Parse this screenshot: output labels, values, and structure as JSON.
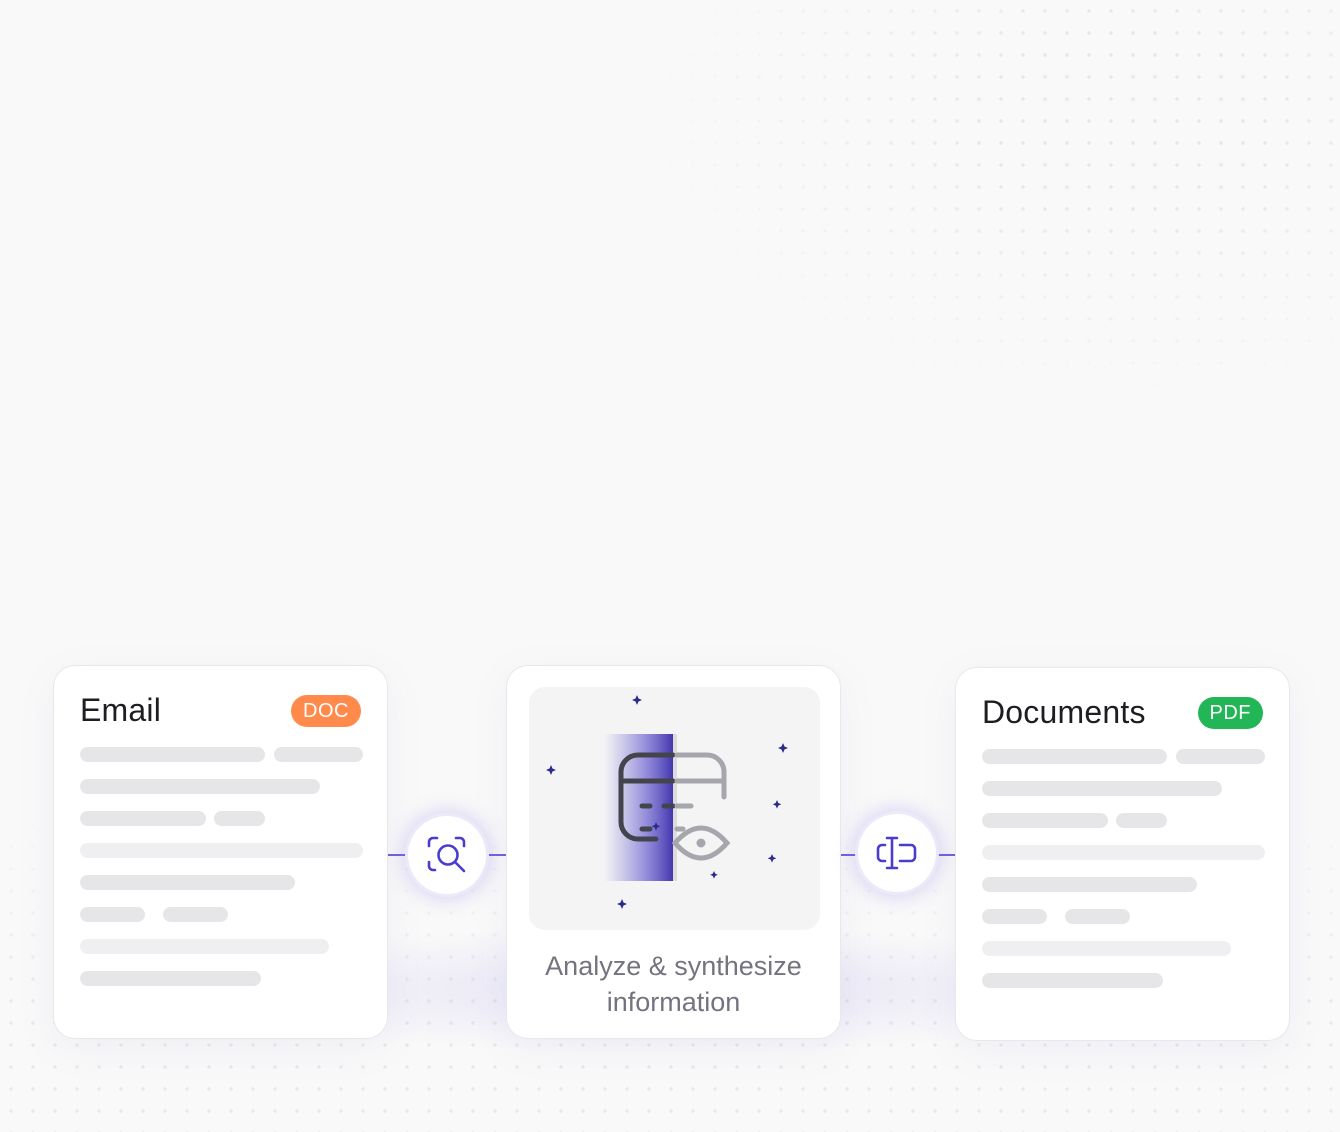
{
  "colors": {
    "accent": "#4b3ccf",
    "doc_badge": "#ff8a4c",
    "pdf_badge": "#22b657",
    "skeleton": "#e6e6e8",
    "sparkle": "#2d2a8c"
  },
  "email_card": {
    "title": "Email",
    "badge": "DOC"
  },
  "center_card": {
    "label_line1": "Analyze & synthesize",
    "label_line2": "information",
    "icon": "ai-face-scan-icon"
  },
  "documents_card": {
    "title": "Documents",
    "badge": "PDF"
  },
  "connectors": [
    {
      "icon": "search-scan-icon"
    },
    {
      "icon": "text-cursor-icon"
    }
  ]
}
